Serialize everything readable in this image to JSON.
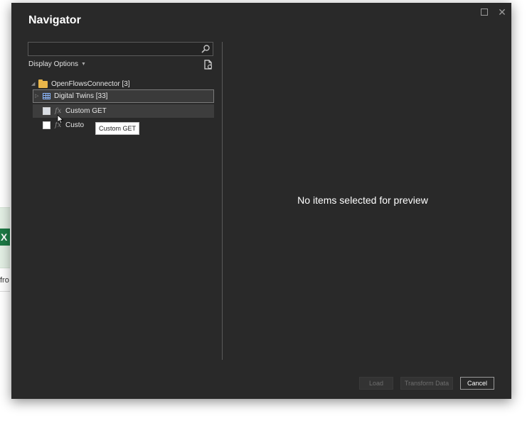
{
  "background": {
    "excel_icon_letter": "X",
    "partial_text": "fro"
  },
  "dialog": {
    "title": "Navigator",
    "window_controls": {
      "maximize_icon": "maximize-icon",
      "close_icon": "close-icon",
      "close_glyph": "✕"
    },
    "search": {
      "value": "",
      "placeholder": "",
      "icon": "search-icon"
    },
    "display_options": {
      "label": "Display Options",
      "chevron": "▼"
    },
    "tree": {
      "root": {
        "label": "OpenFlowsConnector [3]",
        "expanded": true,
        "icon": "folder-icon"
      },
      "items": [
        {
          "label": "Digital Twins [33]",
          "icon": "table-icon",
          "expanded": false,
          "selected": true
        },
        {
          "label": "Custom GET",
          "icon": "function-icon",
          "checked": false,
          "hovered": true
        },
        {
          "label": "Custo",
          "icon": "function-icon",
          "checked": false
        }
      ],
      "fx_glyph": "fx",
      "twisty_collapsed": "▷",
      "twisty_expanded": "◢"
    },
    "tooltip": "Custom GET",
    "preview_message": "No items selected for preview",
    "buttons": {
      "load": "Load",
      "transform": "Transform Data",
      "cancel": "Cancel"
    }
  },
  "colors": {
    "dialog_bg": "#292929",
    "text": "#ffffff",
    "folder": "#e9b64a",
    "table_icon": "#8ab4f8",
    "excel_green": "#1d7a45"
  }
}
